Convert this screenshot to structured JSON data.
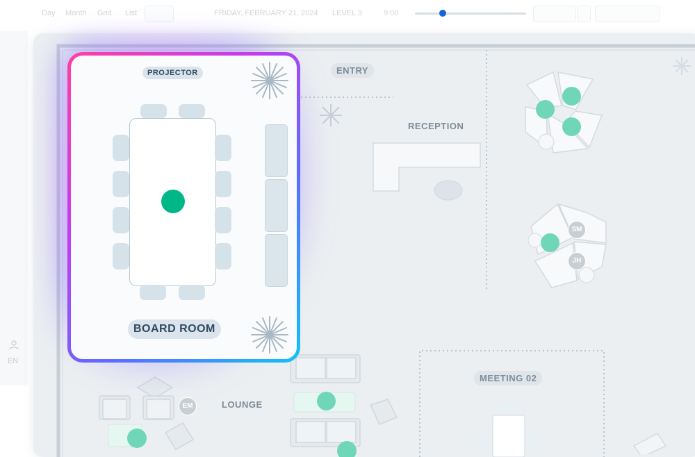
{
  "toolbar": {
    "view_day": "Day",
    "view_month": "Month",
    "view_grid": "Grid",
    "view_list": "List",
    "date": "FRIDAY, FEBRUARY 21, 2024",
    "level": "LEVEL 3",
    "time": "9:00"
  },
  "sidebar": {
    "language": "EN"
  },
  "floor_plan": {
    "rooms": {
      "board_room": "BOARD ROOM",
      "projector": "PROJECTOR",
      "entry": "ENTRY",
      "reception": "RECEPTION",
      "lounge": "LOUNGE",
      "meeting_02": "MEETING 02"
    },
    "avatars": {
      "sm": "SM",
      "jh": "JH",
      "em": "EM"
    }
  },
  "colors": {
    "occupied": "#00b887",
    "available": "#7fdcc2",
    "accent_blue": "#1565d8",
    "label_bg": "#dbe4ec",
    "label_text": "#2f4a60"
  },
  "icons": [
    "user-icon",
    "plant-icon",
    "slider-knob"
  ]
}
